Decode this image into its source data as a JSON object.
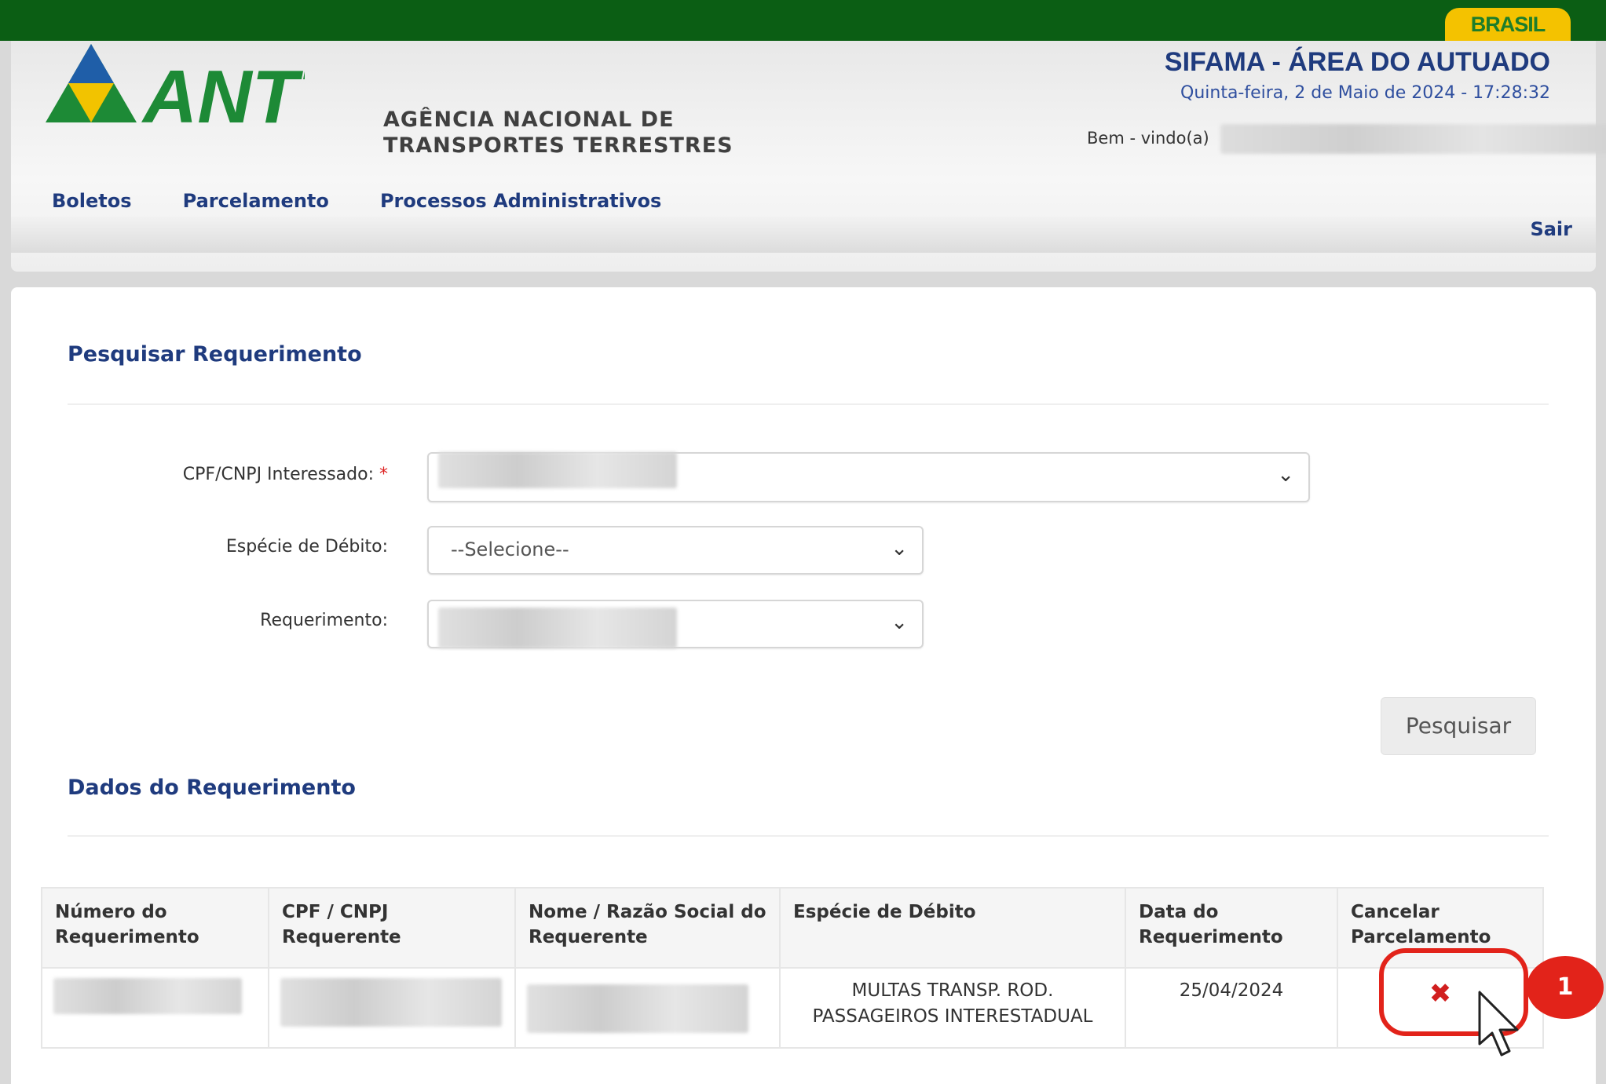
{
  "topbar": {
    "brand": "BRASIL"
  },
  "header": {
    "logo_text": "ANTT",
    "agency_line1": "AGÊNCIA NACIONAL DE",
    "agency_line2": "TRANSPORTES TERRESTRES",
    "system_title": "SIFAMA - ÁREA DO AUTUADO",
    "datetime": "Quinta-feira, 2 de Maio de 2024 - 17:28:32",
    "welcome": "Bem - vindo(a)",
    "logout": "Sair"
  },
  "nav": {
    "items": [
      {
        "label": "Boletos"
      },
      {
        "label": "Parcelamento"
      },
      {
        "label": "Processos Administrativos"
      }
    ]
  },
  "search": {
    "title": "Pesquisar Requerimento",
    "cpf_label": "CPF/CNPJ Interessado:",
    "required_mark": "*",
    "especie_label": "Espécie de Débito:",
    "especie_value": "--Selecione--",
    "requerimento_label": "Requerimento:",
    "button": "Pesquisar"
  },
  "results": {
    "title": "Dados do Requerimento",
    "columns": [
      "Número do Requerimento",
      "CPF / CNPJ Requerente",
      "Nome / Razão Social do Requerente",
      "Espécie de Débito",
      "Data do Requerimento",
      "Cancelar Parcelamento"
    ],
    "rows": [
      {
        "especie": "MULTAS TRANSP. ROD. PASSAGEIROS INTERESTADUAL",
        "data": "25/04/2024",
        "cancel_icon": "close-icon"
      }
    ]
  },
  "annotation": {
    "step": "1",
    "color": "#e2231a"
  }
}
